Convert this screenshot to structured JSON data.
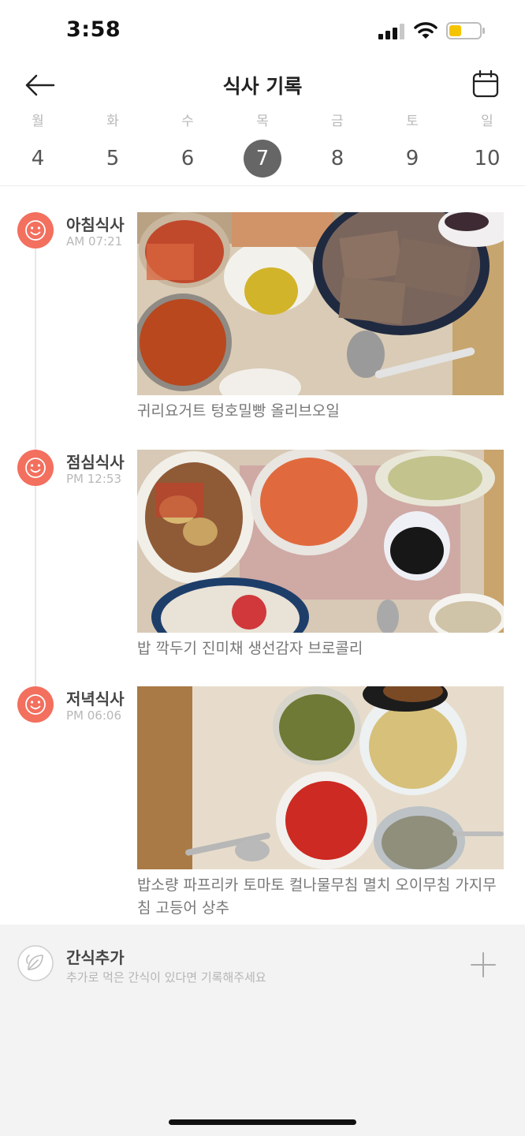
{
  "status_bar": {
    "time": "3:58"
  },
  "header": {
    "title": "식사 기록"
  },
  "week": [
    {
      "day": "월",
      "date": "4"
    },
    {
      "day": "화",
      "date": "5"
    },
    {
      "day": "수",
      "date": "6"
    },
    {
      "day": "목",
      "date": "7",
      "selected": true
    },
    {
      "day": "금",
      "date": "8"
    },
    {
      "day": "토",
      "date": "9"
    },
    {
      "day": "일",
      "date": "10"
    }
  ],
  "meals": [
    {
      "name": "아침식사",
      "time": "AM 07:21",
      "description": "귀리요거트 텅호밀빵 올리브오일"
    },
    {
      "name": "점심식사",
      "time": "PM 12:53",
      "description": "밥 깍두기 진미채 생선감자 브로콜리"
    },
    {
      "name": "저녁식사",
      "time": "PM 06:06",
      "description": "밥소량 파프리카 토마토 컬나물무침 멸치 오이무침 가지무침 고등어 상추"
    }
  ],
  "snack": {
    "title": "간식추가",
    "subtitle": "추가로 먹은 간식이 있다면 기록해주세요"
  },
  "colors": {
    "accent": "#f36f5e",
    "selected_day": "#666666",
    "snack_bg": "#f3f3f3"
  },
  "icons": {
    "back": "arrow-left-icon",
    "calendar": "calendar-icon",
    "meal": "smiley-icon",
    "snack": "leaf-icon",
    "add": "plus-icon"
  }
}
